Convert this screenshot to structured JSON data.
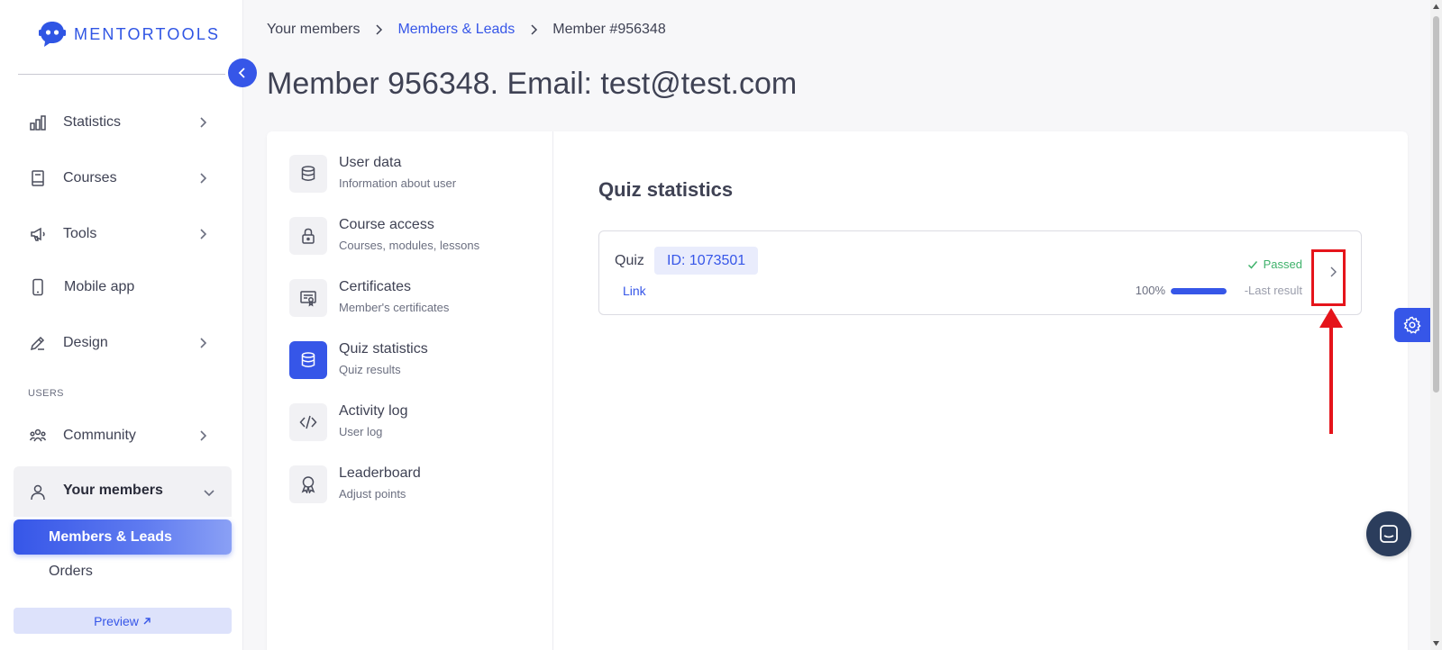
{
  "brand": {
    "name": "MENTORTOOLS",
    "accent": "#3656e8"
  },
  "sidebar": {
    "items": [
      {
        "label": "Statistics",
        "icon": "bar-chart-icon"
      },
      {
        "label": "Courses",
        "icon": "book-icon"
      },
      {
        "label": "Tools",
        "icon": "megaphone-icon"
      },
      {
        "label": "Mobile app",
        "icon": "phone-icon"
      },
      {
        "label": "Design",
        "icon": "pencil-icon"
      }
    ],
    "users_section": "USERS",
    "community": {
      "label": "Community",
      "icon": "people-icon"
    },
    "your_members": {
      "label": "Your members",
      "icon": "user-icon",
      "children": [
        {
          "label": "Members & Leads",
          "active": true
        },
        {
          "label": "Orders"
        }
      ]
    },
    "preview_label": "Preview"
  },
  "breadcrumb": {
    "items": [
      "Your members",
      "Members & Leads",
      "Member #956348"
    ]
  },
  "page_title": "Member 956348. Email: test@test.com",
  "member_menu": [
    {
      "title": "User data",
      "subtitle": "Information about user",
      "icon": "database-icon"
    },
    {
      "title": "Course access",
      "subtitle": "Courses, modules, lessons",
      "icon": "lock-icon"
    },
    {
      "title": "Certificates",
      "subtitle": "Member's certificates",
      "icon": "certificate-icon"
    },
    {
      "title": "Quiz statistics",
      "subtitle": "Quiz results",
      "icon": "database-icon",
      "active": true
    },
    {
      "title": "Activity log",
      "subtitle": "User log",
      "icon": "code-icon"
    },
    {
      "title": "Leaderboard",
      "subtitle": "Adjust points",
      "icon": "award-icon"
    }
  ],
  "quiz_section": {
    "title": "Quiz statistics",
    "quiz": {
      "label": "Quiz",
      "id_badge": "ID: 1073501",
      "link_label": "Link",
      "status": "Passed",
      "status_color": "#3fb26b",
      "score_text": "100%",
      "score_fraction": 1.0,
      "last_result_label": "-Last result"
    }
  }
}
